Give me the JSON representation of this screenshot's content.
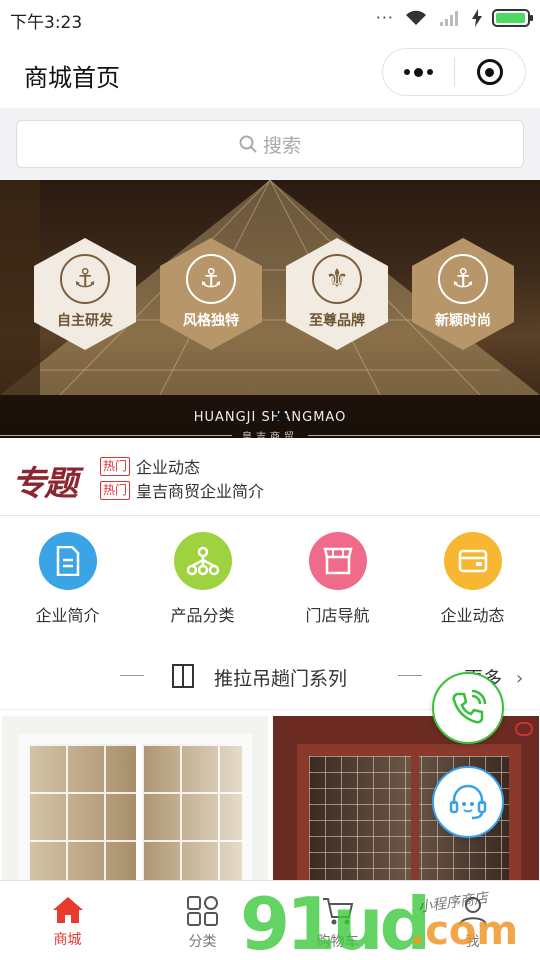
{
  "status_bar": {
    "time": "下午3:23",
    "signal_icon": "wifi-icon",
    "battery_level": 0.95
  },
  "nav": {
    "title": "商城首页"
  },
  "search": {
    "placeholder": "搜索"
  },
  "banner": {
    "items": [
      {
        "label": "自主研发",
        "style": "light",
        "emblem": "⚓"
      },
      {
        "label": "风格独特",
        "style": "gold",
        "emblem": "⚓"
      },
      {
        "label": "至尊品牌",
        "style": "light",
        "emblem": "⚜"
      },
      {
        "label": "新颖时尚",
        "style": "gold",
        "emblem": "⚓"
      }
    ],
    "brand_en": "HUANGJI SHANGMAO",
    "brand_cn": "皇吉商贸"
  },
  "topics": {
    "logo": "专题",
    "items": [
      {
        "tag": "热门",
        "text": "企业动态"
      },
      {
        "tag": "热门",
        "text": "皇吉商贸企业简介"
      }
    ]
  },
  "categories": [
    {
      "label": "企业简介",
      "icon": "document-icon",
      "color": "#3aa4e6"
    },
    {
      "label": "产品分类",
      "icon": "hierarchy-icon",
      "color": "#9fd23f"
    },
    {
      "label": "门店导航",
      "icon": "store-icon",
      "color": "#f06a8a"
    },
    {
      "label": "企业动态",
      "icon": "wallet-icon",
      "color": "#f7b733"
    }
  ],
  "section": {
    "title": "推拉吊趟门系列",
    "more": "更多"
  },
  "tabs": [
    {
      "label": "商城",
      "icon": "home-icon",
      "active": true
    },
    {
      "label": "分类",
      "icon": "grid-icon",
      "active": false
    },
    {
      "label": "购物车",
      "icon": "cart-icon",
      "active": false
    },
    {
      "label": "我",
      "icon": "user-icon",
      "active": false
    }
  ],
  "watermark": {
    "number": "91ud",
    "domain": ".com",
    "handwriting": "小程序商店"
  },
  "colors": {
    "accent": "#e63b2e",
    "phone": "#3bbf3b",
    "service": "#3aa0e8"
  }
}
